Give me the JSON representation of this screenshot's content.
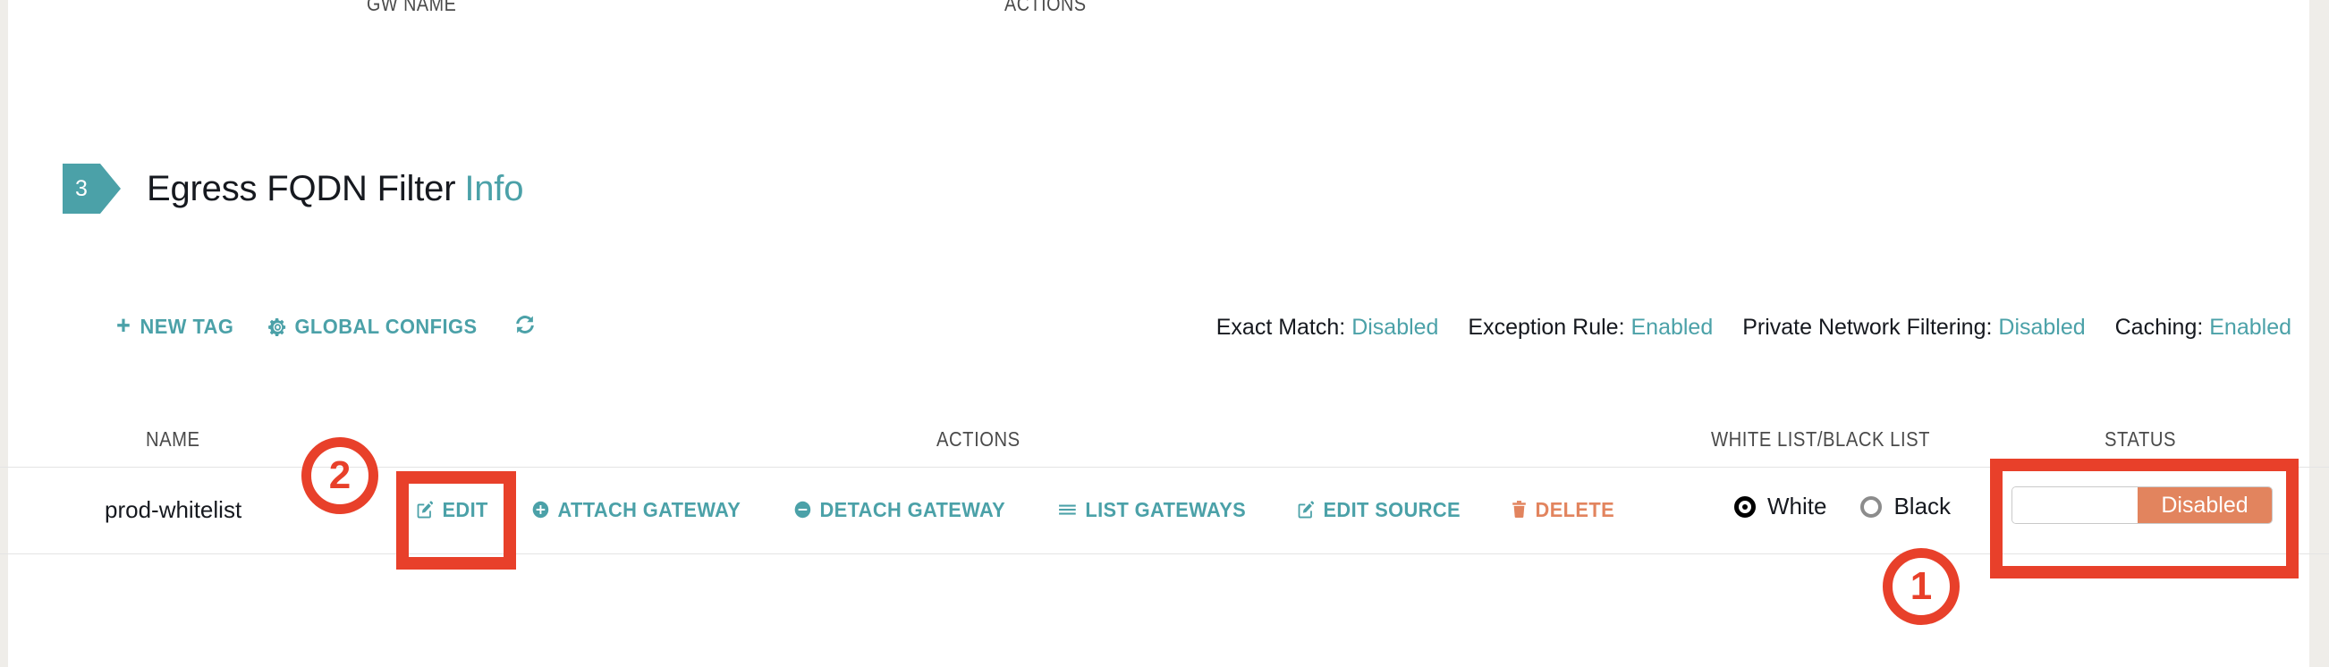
{
  "top_table": {
    "headers": [
      "GW NAME",
      "ACTIONS"
    ]
  },
  "section": {
    "step_number": "3",
    "title": "Egress FQDN Filter",
    "info_link": "Info"
  },
  "toolbar": {
    "new_tag_label": "NEW TAG",
    "global_configs_label": "GLOBAL CONFIGS",
    "refresh_icon": "refresh-icon",
    "new_tag_icon": "plus-icon",
    "global_configs_icon": "gear-icon"
  },
  "config_summary": [
    {
      "label": "Exact Match:",
      "value": "Disabled"
    },
    {
      "label": "Exception Rule:",
      "value": "Enabled"
    },
    {
      "label": "Private Network Filtering:",
      "value": "Disabled"
    },
    {
      "label": "Caching:",
      "value": "Enabled"
    }
  ],
  "table": {
    "headers": {
      "name": "NAME",
      "actions": "ACTIONS",
      "white_black_list": "WHITE LIST/BLACK LIST",
      "status": "STATUS"
    },
    "row": {
      "name": "prod-whitelist",
      "actions": [
        {
          "label": "EDIT",
          "icon": "pencil-square-icon",
          "variant": "link"
        },
        {
          "label": "ATTACH GATEWAY",
          "icon": "plus-circle-icon",
          "variant": "link"
        },
        {
          "label": "DETACH GATEWAY",
          "icon": "minus-circle-icon",
          "variant": "link"
        },
        {
          "label": "LIST GATEWAYS",
          "icon": "list-icon",
          "variant": "link"
        },
        {
          "label": "EDIT SOURCE",
          "icon": "pencil-square-icon",
          "variant": "link"
        },
        {
          "label": "DELETE",
          "icon": "trash-icon",
          "variant": "danger"
        }
      ],
      "list_mode": {
        "options": [
          {
            "label": "White",
            "selected": true
          },
          {
            "label": "Black",
            "selected": false
          }
        ]
      },
      "status": {
        "state_label": "Disabled",
        "enabled": false
      }
    }
  },
  "annotations": [
    {
      "id": "1",
      "target": "status-toggle"
    },
    {
      "id": "2",
      "target": "edit-button"
    }
  ],
  "colors": {
    "teal": "#4ba1a8",
    "salmon": "#e2845e",
    "annotation_red": "#e8402a",
    "text": "#16191f",
    "muted": "#4a4a4a"
  }
}
